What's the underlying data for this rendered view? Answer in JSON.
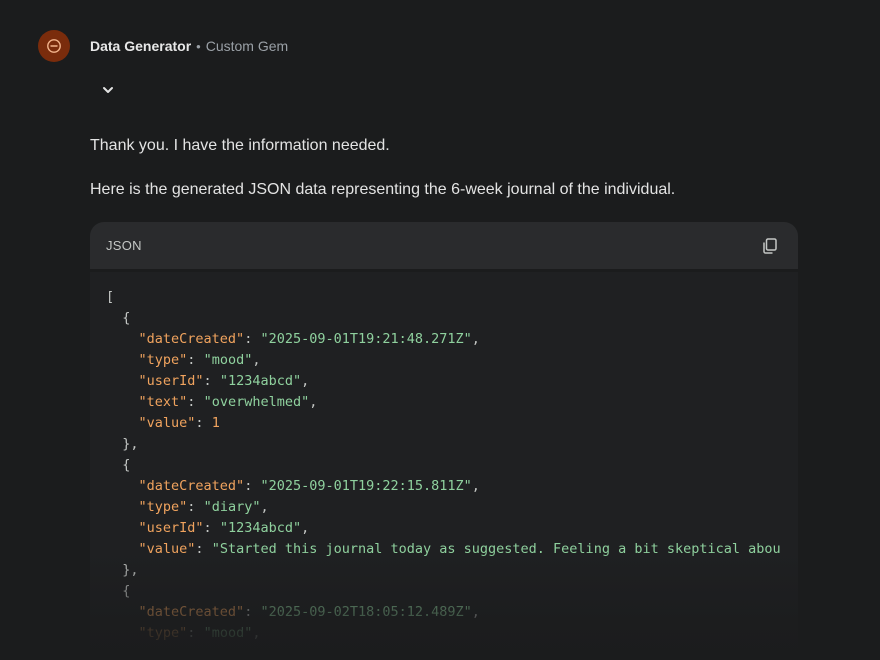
{
  "header": {
    "gem_name": "Data Generator",
    "separator": "•",
    "gem_type": "Custom Gem",
    "avatar_icon": "circle-minus-icon",
    "avatar_color": "#7a2c0c"
  },
  "expand_icon": "chevron-down-icon",
  "message": {
    "paragraph_1": "Thank you. I have the information needed.",
    "paragraph_2": "Here is the generated JSON data representing the 6-week journal of the individual."
  },
  "code_block": {
    "language": "JSON",
    "copy_icon": "copy-icon",
    "lines": [
      [
        {
          "t": "punc",
          "v": "["
        }
      ],
      [
        {
          "t": "punc",
          "v": "  {"
        }
      ],
      [
        {
          "t": "punc",
          "v": "    "
        },
        {
          "t": "key",
          "v": "\"dateCreated\""
        },
        {
          "t": "punc",
          "v": ": "
        },
        {
          "t": "str",
          "v": "\"2025-09-01T19:21:48.271Z\""
        },
        {
          "t": "punc",
          "v": ","
        }
      ],
      [
        {
          "t": "punc",
          "v": "    "
        },
        {
          "t": "key",
          "v": "\"type\""
        },
        {
          "t": "punc",
          "v": ": "
        },
        {
          "t": "str",
          "v": "\"mood\""
        },
        {
          "t": "punc",
          "v": ","
        }
      ],
      [
        {
          "t": "punc",
          "v": "    "
        },
        {
          "t": "key",
          "v": "\"userId\""
        },
        {
          "t": "punc",
          "v": ": "
        },
        {
          "t": "str",
          "v": "\"1234abcd\""
        },
        {
          "t": "punc",
          "v": ","
        }
      ],
      [
        {
          "t": "punc",
          "v": "    "
        },
        {
          "t": "key",
          "v": "\"text\""
        },
        {
          "t": "punc",
          "v": ": "
        },
        {
          "t": "str",
          "v": "\"overwhelmed\""
        },
        {
          "t": "punc",
          "v": ","
        }
      ],
      [
        {
          "t": "punc",
          "v": "    "
        },
        {
          "t": "key",
          "v": "\"value\""
        },
        {
          "t": "punc",
          "v": ": "
        },
        {
          "t": "num",
          "v": "1"
        }
      ],
      [
        {
          "t": "punc",
          "v": "  },"
        }
      ],
      [
        {
          "t": "punc",
          "v": "  {"
        }
      ],
      [
        {
          "t": "punc",
          "v": "    "
        },
        {
          "t": "key",
          "v": "\"dateCreated\""
        },
        {
          "t": "punc",
          "v": ": "
        },
        {
          "t": "str",
          "v": "\"2025-09-01T19:22:15.811Z\""
        },
        {
          "t": "punc",
          "v": ","
        }
      ],
      [
        {
          "t": "punc",
          "v": "    "
        },
        {
          "t": "key",
          "v": "\"type\""
        },
        {
          "t": "punc",
          "v": ": "
        },
        {
          "t": "str",
          "v": "\"diary\""
        },
        {
          "t": "punc",
          "v": ","
        }
      ],
      [
        {
          "t": "punc",
          "v": "    "
        },
        {
          "t": "key",
          "v": "\"userId\""
        },
        {
          "t": "punc",
          "v": ": "
        },
        {
          "t": "str",
          "v": "\"1234abcd\""
        },
        {
          "t": "punc",
          "v": ","
        }
      ],
      [
        {
          "t": "punc",
          "v": "    "
        },
        {
          "t": "key",
          "v": "\"value\""
        },
        {
          "t": "punc",
          "v": ": "
        },
        {
          "t": "str",
          "v": "\"Started this journal today as suggested. Feeling a bit skeptical abou"
        }
      ],
      [
        {
          "t": "punc",
          "v": "  },"
        }
      ],
      [
        {
          "t": "punc",
          "v": "  {"
        }
      ],
      [
        {
          "t": "punc",
          "v": "    "
        },
        {
          "t": "key",
          "v": "\"dateCreated\""
        },
        {
          "t": "punc",
          "v": ": "
        },
        {
          "t": "str",
          "v": "\"2025-09-02T18:05:12.489Z\""
        },
        {
          "t": "punc",
          "v": ","
        }
      ],
      [
        {
          "t": "punc",
          "v": "    "
        },
        {
          "t": "key",
          "v": "\"type\""
        },
        {
          "t": "punc",
          "v": ": "
        },
        {
          "t": "str",
          "v": "\"mood\""
        },
        {
          "t": "punc",
          "v": ","
        }
      ]
    ]
  },
  "colors": {
    "background": "#1b1c1d",
    "code_header_bg": "#2a2b2d",
    "code_body_bg": "#1f2022",
    "json_key": "#f0a35e",
    "json_string": "#8fd19e",
    "json_number": "#f0a35e"
  }
}
